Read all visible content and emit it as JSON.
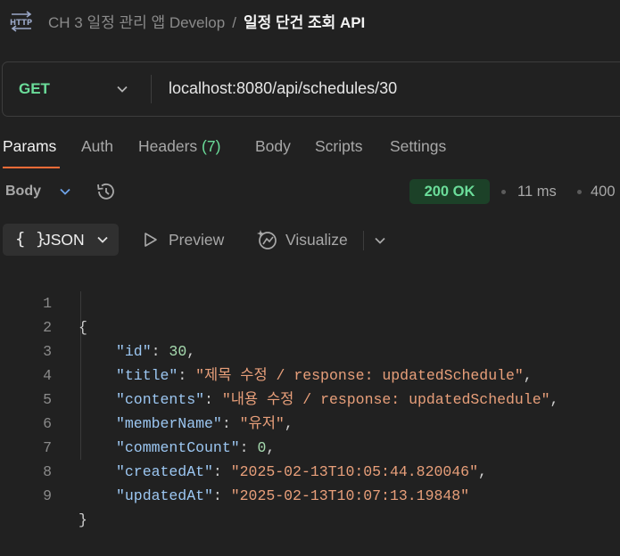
{
  "header": {
    "icon": "http-icon",
    "collection": "CH 3 일정 관리 앱 Develop",
    "separator": "/",
    "request_name": "일정 단건 조회 API"
  },
  "request": {
    "method": "GET",
    "url": "localhost:8080/api/schedules/30"
  },
  "tabs": [
    {
      "label": "Params",
      "active": true
    },
    {
      "label": "Auth"
    },
    {
      "label": "Headers",
      "count": "(7)"
    },
    {
      "label": "Body"
    },
    {
      "label": "Scripts"
    },
    {
      "label": "Settings"
    }
  ],
  "response": {
    "label": "Body",
    "status": "200 OK",
    "time": "11 ms",
    "size": "400"
  },
  "view": {
    "format_braces": "{ }",
    "format": "JSON",
    "preview": "Preview",
    "visualize": "Visualize"
  },
  "code_lines": [
    {
      "n": "1",
      "text": "{"
    },
    {
      "n": "2",
      "key": "\"id\"",
      "value": "30",
      "type": "num",
      "comma": ","
    },
    {
      "n": "3",
      "key": "\"title\"",
      "value": "\"제목 수정 / response: updatedSchedule\"",
      "type": "str",
      "comma": ","
    },
    {
      "n": "4",
      "key": "\"contents\"",
      "value": "\"내용 수정 / response: updatedSchedule\"",
      "type": "str",
      "comma": ","
    },
    {
      "n": "5",
      "key": "\"memberName\"",
      "value": "\"유저\"",
      "type": "str",
      "comma": ","
    },
    {
      "n": "6",
      "key": "\"commentCount\"",
      "value": "0",
      "type": "num",
      "comma": ","
    },
    {
      "n": "7",
      "key": "\"createdAt\"",
      "value": "\"2025-02-13T10:05:44.820046\"",
      "type": "str",
      "comma": ","
    },
    {
      "n": "8",
      "key": "\"updatedAt\"",
      "value": "\"2025-02-13T10:07:13.19848\"",
      "type": "str",
      "comma": ""
    },
    {
      "n": "9",
      "text": "}"
    }
  ],
  "colors": {
    "accent": "#ff6c37",
    "success": "#6bdd9a",
    "json_key": "#9cc7f2",
    "json_string": "#e89f7a",
    "json_number": "#a7dcb0"
  }
}
